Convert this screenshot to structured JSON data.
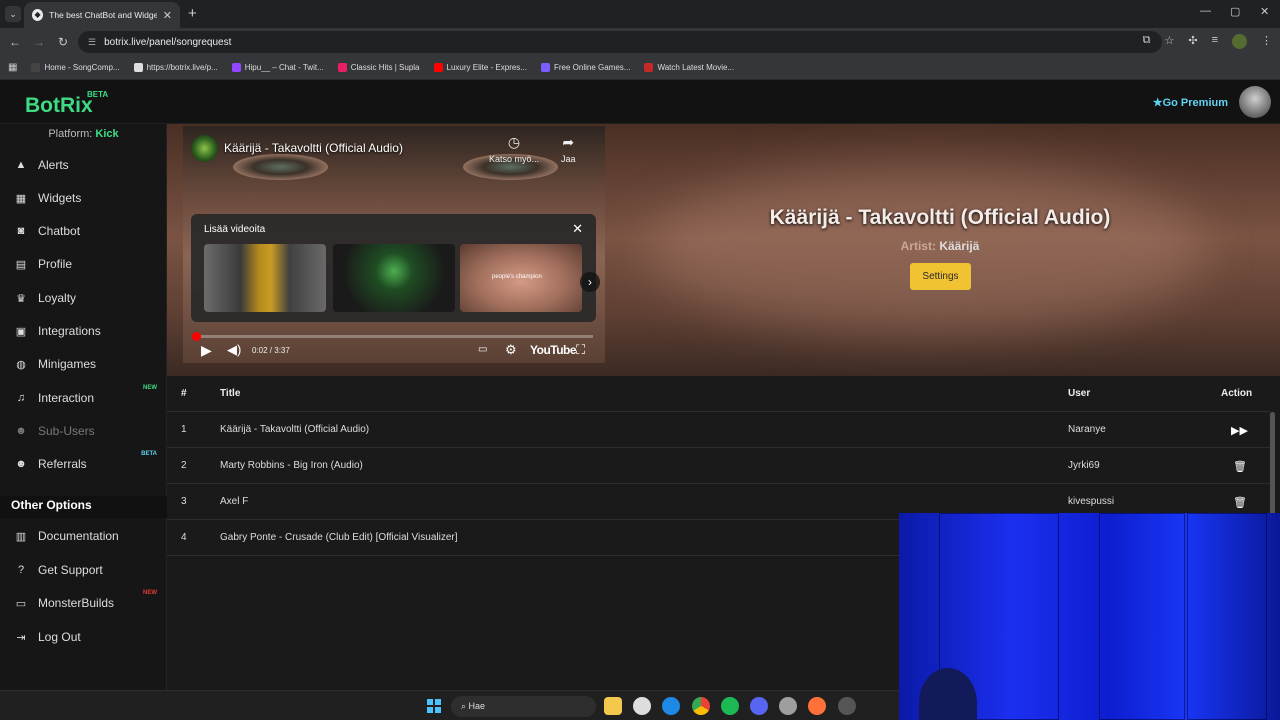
{
  "browser": {
    "tab_title": "The best ChatBot and Widgets f",
    "url": "botrix.live/panel/songrequest",
    "bookmarks": [
      {
        "label": "Home - SongComp...",
        "color": "#444"
      },
      {
        "label": "https://botrix.live/p...",
        "color": "#ddd"
      },
      {
        "label": "Hipu__ – Chat - Twit...",
        "color": "#9146ff"
      },
      {
        "label": "Classic Hits | Supla",
        "color": "#e91e63"
      },
      {
        "label": "Luxury Elite - Expres...",
        "color": "#ff0000"
      },
      {
        "label": "Free Online Games...",
        "color": "#7b5cff"
      },
      {
        "label": "Watch Latest Movie...",
        "color": "#c62828"
      }
    ]
  },
  "app": {
    "logo": "BotRix",
    "logo_badge": "BETA",
    "premium": "Go Premium",
    "platform_label": "Platform:",
    "platform_value": "Kick"
  },
  "sidebar": {
    "items": [
      {
        "label": "Alerts",
        "icon": "warning-icon",
        "badge": ""
      },
      {
        "label": "Widgets",
        "icon": "grid-icon",
        "badge": ""
      },
      {
        "label": "Chatbot",
        "icon": "robot-icon",
        "badge": ""
      },
      {
        "label": "Profile",
        "icon": "id-card-icon",
        "badge": ""
      },
      {
        "label": "Loyalty",
        "icon": "trophy-icon",
        "badge": ""
      },
      {
        "label": "Integrations",
        "icon": "plug-icon",
        "badge": ""
      },
      {
        "label": "Minigames",
        "icon": "gamepad-icon",
        "badge": ""
      },
      {
        "label": "Interaction",
        "icon": "music-icon",
        "badge": "NEW"
      },
      {
        "label": "Sub-Users",
        "icon": "users-icon",
        "badge": ""
      },
      {
        "label": "Referrals",
        "icon": "user-group-icon",
        "badge": "BETA"
      }
    ],
    "other_heading": "Other Options",
    "other_items": [
      {
        "label": "Documentation",
        "icon": "book-icon",
        "badge": ""
      },
      {
        "label": "Get Support",
        "icon": "question-icon",
        "badge": ""
      },
      {
        "label": "MonsterBuilds",
        "icon": "laptop-icon",
        "badge": "NEW"
      },
      {
        "label": "Log Out",
        "icon": "logout-icon",
        "badge": ""
      }
    ]
  },
  "player": {
    "video_title": "Käärijä - Takavoltti (Official Audio)",
    "watch_later": "Katso myö...",
    "share": "Jaa",
    "more_videos": "Lisää videoita",
    "thumb3_caption": "people's champion",
    "time": "0:02 / 3:37",
    "logo": "YouTube"
  },
  "now_playing": {
    "title": "Käärijä - Takavoltti (Official Audio)",
    "artist_label": "Artist:",
    "artist": "Käärijä",
    "settings": "Settings"
  },
  "queue": {
    "headers": {
      "num": "#",
      "title": "Title",
      "user": "User",
      "action": "Action"
    },
    "rows": [
      {
        "num": "1",
        "title": "Käärijä - Takavoltti (Official Audio)",
        "user": "Naranye",
        "action": "skip-icon"
      },
      {
        "num": "2",
        "title": "Marty Robbins - Big Iron (Audio)",
        "user": "Jyrki69",
        "action": "trash-icon"
      },
      {
        "num": "3",
        "title": "Axel F",
        "user": "kivespussi",
        "action": "trash-icon"
      },
      {
        "num": "4",
        "title": "Gabry Ponte - Crusade (Club Edit) [Official Visualizer]",
        "user": "",
        "action": ""
      }
    ]
  },
  "taskbar": {
    "search": "Hae"
  }
}
